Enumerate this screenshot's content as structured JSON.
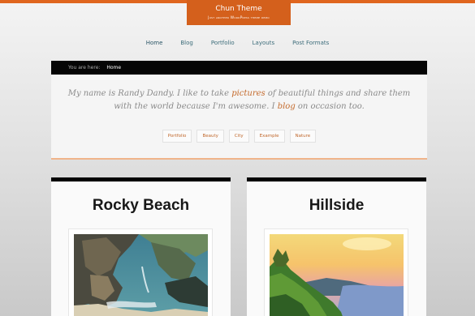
{
  "site": {
    "title": "Chun Theme",
    "tagline": "Just another WordPress theme demo"
  },
  "nav": {
    "items": [
      "Home",
      "Blog",
      "Portfolio",
      "Layouts",
      "Post Formats"
    ]
  },
  "breadcrumb": {
    "label": "You are here:",
    "current": "Home"
  },
  "intro": {
    "text_1": "My name is Randy Dandy. I like to take ",
    "link_1": "pictures",
    "text_2": " of beautiful things and share them with the world because I'm awesome. I ",
    "link_2": "blog",
    "text_3": " on occasion too."
  },
  "tags": [
    "Portfolio",
    "Beauty",
    "City",
    "Example",
    "Nature"
  ],
  "posts": [
    {
      "title": "Rocky Beach"
    },
    {
      "title": "Hillside"
    }
  ],
  "colors": {
    "accent": "#d4601c",
    "link": "#c46a2c",
    "nav": "#3c6c7a"
  }
}
